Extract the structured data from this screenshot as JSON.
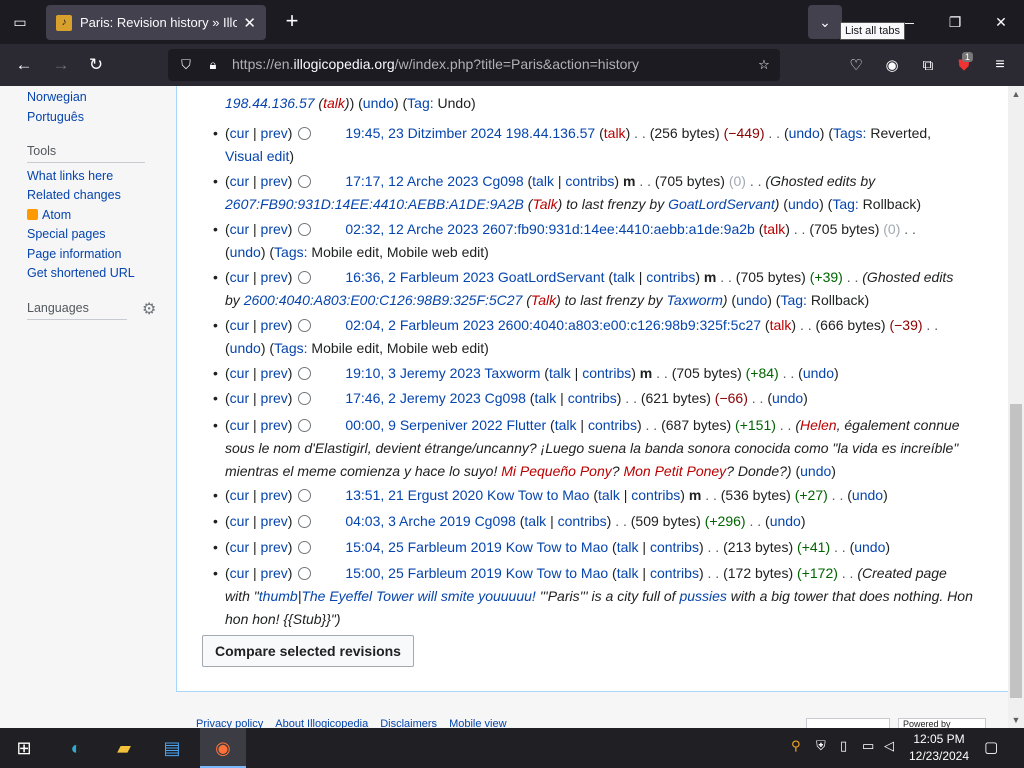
{
  "browser": {
    "tab_title": "Paris: Revision history » Illogicopedia",
    "tab_favicon": "illogicopedia-favicon",
    "list_tabs_tooltip": "List all tabs",
    "url_prefix": "https://en.",
    "url_domain": "illogicopedia.org",
    "url_path": "/w/index.php?title=Paris&action=history",
    "extension_badge": "1"
  },
  "sidebar": {
    "lang_links": [
      "Norwegian",
      "Português"
    ],
    "tools_heading": "Tools",
    "tools": [
      "What links here",
      "Related changes",
      "Atom",
      "Special pages",
      "Page information",
      "Get shortened URL"
    ],
    "languages_heading": "Languages"
  },
  "history": {
    "top_partial": "198.44.136.57",
    "top_talk": "talk",
    "top_undo": "undo",
    "top_tag_label": "Tag:",
    "top_tag": "Undo",
    "entries": [
      {
        "date": "19:45, 23 Ditzimber 2024",
        "user": "198.44.136.57",
        "links": [
          "talk"
        ],
        "minor": false,
        "size": "(256 bytes)",
        "diff": "(−449)",
        "diff_kind": "neg",
        "line2": "Visual edit"
      },
      {
        "date": "17:17, 12 Arche 2023",
        "user": "Cg098",
        "links": [
          "talk",
          "contribs"
        ],
        "minor": true,
        "size": "(705 bytes)",
        "diff": "(0)",
        "diff_kind": "zero",
        "comment": "(Ghosted edits by"
      },
      {
        "date": "02:32, 12 Arche 2023",
        "user": "2607:fb90:931d:14ee:4410:aebb:a1de:9a2b",
        "links": [
          "talk"
        ],
        "minor": false,
        "size": "(705 bytes)",
        "diff": "(0)",
        "diff_kind": "zero"
      },
      {
        "date": "16:36, 2 Farbleum 2023",
        "user": "GoatLordServant",
        "links": [
          "talk",
          "contribs"
        ],
        "minor": true,
        "size": "(705 bytes)",
        "diff": "(+39)",
        "diff_kind": "pos",
        "comment": "(Ghosted edits"
      },
      {
        "date": "02:04, 2 Farbleum 2023",
        "user": "2600:4040:a803:e00:c126:98b9:325f:5c27",
        "links": [
          "talk"
        ],
        "minor": false,
        "size": "(666 bytes)",
        "diff": "(−39)",
        "diff_kind": "neg"
      },
      {
        "date": "19:10, 3 Jeremy 2023",
        "user": "Taxworm",
        "links": [
          "talk",
          "contribs"
        ],
        "minor": true,
        "size": "(705 bytes)",
        "diff": "(+84)",
        "diff_kind": "pos"
      },
      {
        "date": "17:46, 2 Jeremy 2023",
        "user": "Cg098",
        "links": [
          "talk",
          "contribs"
        ],
        "minor": false,
        "size": "(621 bytes)",
        "diff": "(−66)",
        "diff_kind": "neg"
      },
      {
        "date": "00:00, 9 Serpeniver 2022",
        "user": "Flutter",
        "links": [
          "talk",
          "contribs"
        ],
        "minor": false,
        "size": "(687 bytes)",
        "diff": "(+151)",
        "diff_kind": "pos"
      },
      {
        "date": "13:51, 21 Ergust 2020",
        "user": "Kow Tow to Mao",
        "links": [
          "talk",
          "contribs"
        ],
        "minor": true,
        "size": "(536 bytes)",
        "diff": "(+27)",
        "diff_kind": "pos"
      },
      {
        "date": "04:03, 3 Arche 2019",
        "user": "Cg098",
        "links": [
          "talk",
          "contribs"
        ],
        "minor": false,
        "size": "(509 bytes)",
        "diff": "(+296)",
        "diff_kind": "pos"
      },
      {
        "date": "15:04, 25 Farbleum 2019",
        "user": "Kow Tow to Mao",
        "links": [
          "talk",
          "contribs"
        ],
        "minor": false,
        "size": "(213 bytes)",
        "diff": "(+41)",
        "diff_kind": "pos"
      },
      {
        "date": "15:00, 25 Farbleum 2019",
        "user": "Kow Tow to Mao",
        "links": [
          "talk",
          "contribs"
        ],
        "minor": false,
        "size": "(172 bytes)",
        "diff": "(+172)",
        "diff_kind": "pos",
        "comment": "(Created page"
      }
    ],
    "labels": {
      "cur": "cur",
      "prev": "prev",
      "minor": "m",
      "undo": "undo",
      "rollback": "Rollback",
      "tags": "Tags:",
      "tag": "Tag:",
      "reverted": "Reverted",
      "mobile_edit": "Mobile edit",
      "mobile_web_edit": "Mobile web edit"
    },
    "comments": {
      "e1_ip": "2607:FB90:931D:14EE:4410:AEBB:A1DE:9A2B",
      "e1_talk": "Talk",
      "e1_mid": ") to last frenzy by ",
      "e1_user": "GoatLordServant",
      "e3_by": "by ",
      "e3_ip": "2600:4040:A803:E00:C126:98B9:325F:5C27",
      "e3_user": "Taxworm",
      "e7_user": "Helen",
      "e7_a": ", également connue",
      "e7_b": "sous le nom d'Elastigirl, devient étrange/uncanny? ¡Luego suena la banda sonora conocida como \"la vida es increíble\"",
      "e7_c": "mientras el meme comienza y hace lo suyo! ",
      "e7_link1": "Mi Pequeño Pony",
      "e7_link2": "Mon Petit Poney",
      "e7_d": "? Donde?)",
      "e11_a": "with \"",
      "e11_link1": "thumb",
      "e11_link2": "The Eyeffel Tower will smite youuuuu!",
      "e11_b": " '''Paris''' is a city full of ",
      "e11_link3": "pussies",
      "e11_c": " with a big tower that does nothing. Hon",
      "e11_d": "hon hon! {{Stub}}\")"
    },
    "compare_button": "Compare selected revisions"
  },
  "footer": {
    "links": [
      "Privacy policy",
      "About Illogicopedia",
      "Disclaimers",
      "Mobile view"
    ],
    "powered_by": "Powered by"
  },
  "taskbar": {
    "time": "12:05 PM",
    "date": "12/23/2024"
  }
}
